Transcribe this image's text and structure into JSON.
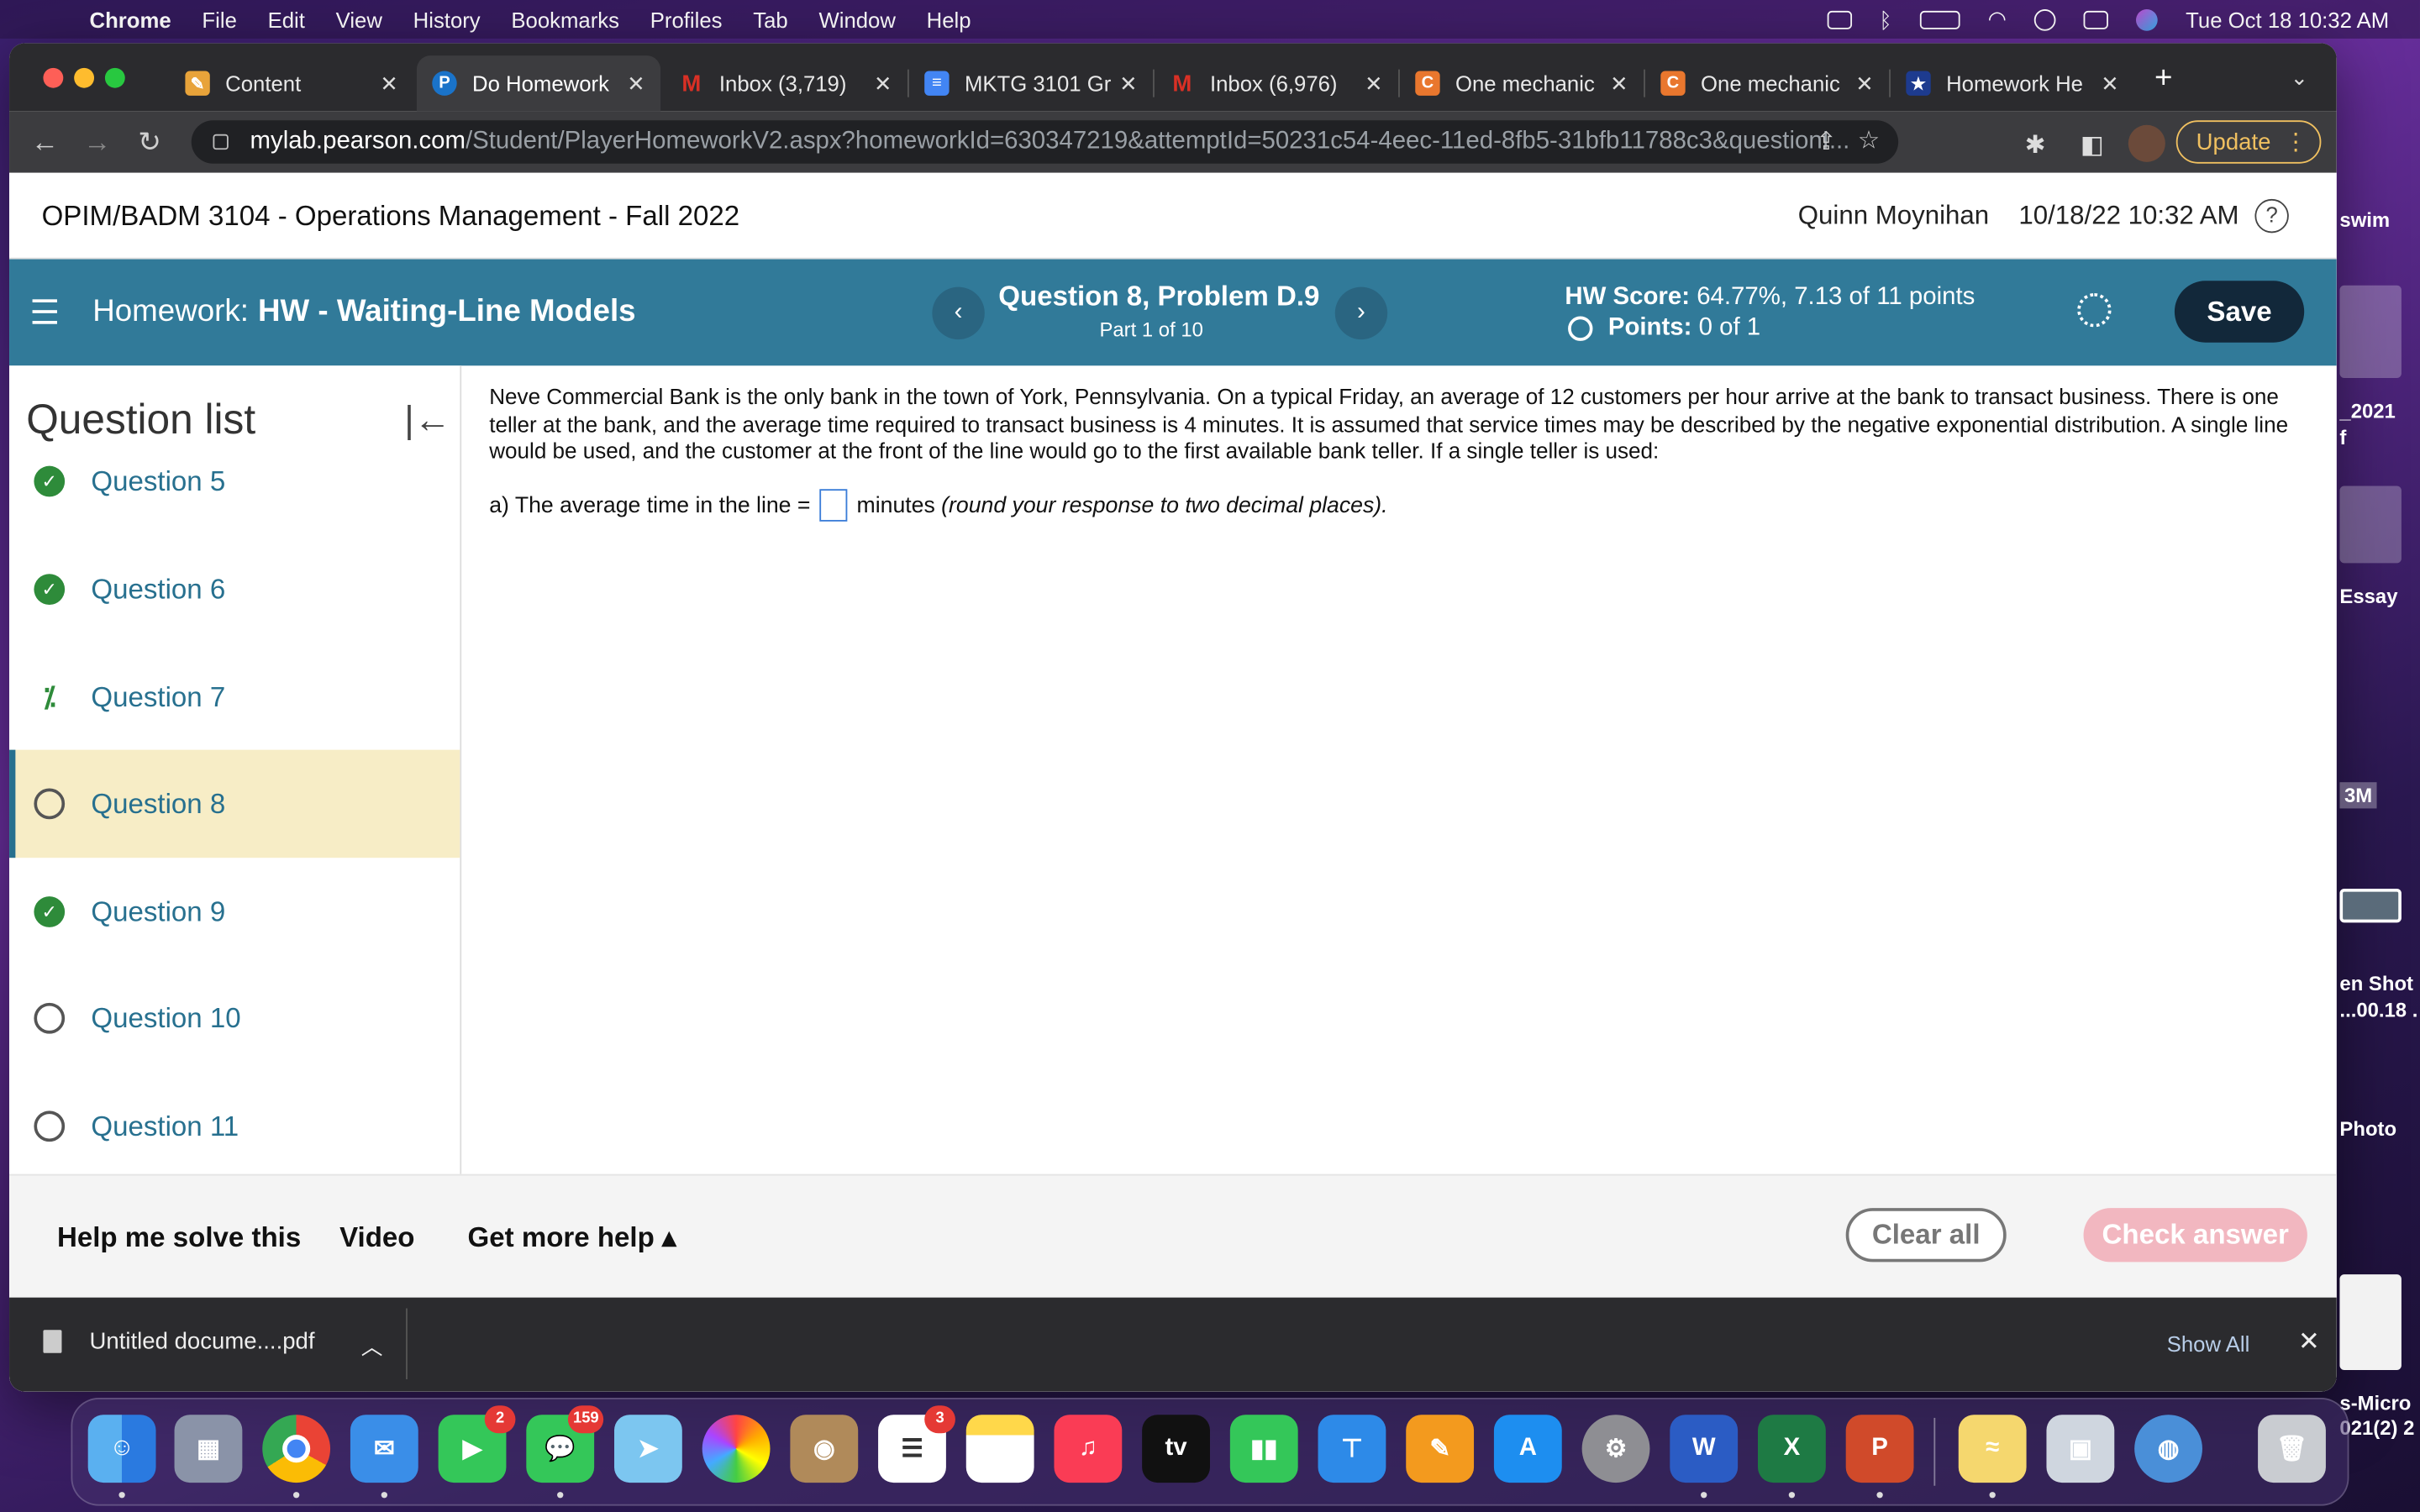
{
  "menubar": {
    "items": [
      "Chrome",
      "File",
      "Edit",
      "View",
      "History",
      "Bookmarks",
      "Profiles",
      "Tab",
      "Window",
      "Help"
    ],
    "clock": "Tue Oct 18  10:32 AM"
  },
  "browser": {
    "tabs": [
      {
        "label": "Content",
        "favicon_color": "#e8a33a",
        "favicon_glyph": "✎"
      },
      {
        "label": "Do Homework",
        "favicon_color": "#1a73c9",
        "favicon_glyph": "P"
      },
      {
        "label": "Inbox (3,719)",
        "favicon_color": "#d93025",
        "favicon_glyph": "M"
      },
      {
        "label": "MKTG 3101 Gr",
        "favicon_color": "#4285f4",
        "favicon_glyph": "≡"
      },
      {
        "label": "Inbox (6,976)",
        "favicon_color": "#d93025",
        "favicon_glyph": "M"
      },
      {
        "label": "One mechanic",
        "favicon_color": "#e9772e",
        "favicon_glyph": "C"
      },
      {
        "label": "One mechanic",
        "favicon_color": "#e9772e",
        "favicon_glyph": "C"
      },
      {
        "label": "Homework He",
        "favicon_color": "#1d3b8f",
        "favicon_glyph": "★"
      }
    ],
    "url_domain": "mylab.pearson.com",
    "url_path": "/Student/PlayerHomeworkV2.aspx?homeworkId=630347219&attemptId=50231c54-4eec-11ed-8fb5-31bfb11788c3&questionI...",
    "update_label": "Update"
  },
  "course": {
    "title": "OPIM/BADM 3104 - Operations Management - Fall 2022",
    "user": "Quinn Moynihan",
    "datetime": "10/18/22 10:32 AM"
  },
  "homework": {
    "prefix": "Homework:",
    "name": "HW - Waiting-Line Models",
    "question_title": "Question 8, Problem D.9",
    "part": "Part 1 of 10",
    "score_label": "HW Score:",
    "score_value": "64.77%, 7.13 of 11 points",
    "points_label": "Points:",
    "points_value": "0 of 1",
    "save_label": "Save"
  },
  "question_list": {
    "title": "Question list",
    "items": [
      {
        "label": "Question 5",
        "status": "done"
      },
      {
        "label": "Question 6",
        "status": "done"
      },
      {
        "label": "Question 7",
        "status": "partial"
      },
      {
        "label": "Question 8",
        "status": "open"
      },
      {
        "label": "Question 9",
        "status": "done"
      },
      {
        "label": "Question 10",
        "status": "open"
      },
      {
        "label": "Question 11",
        "status": "open"
      }
    ]
  },
  "problem": {
    "text": "Neve Commercial Bank is the only bank in the town of York, Pennsylvania. On a typical Friday, an average of 12 customers per hour arrive at the bank to transact business. There is one teller at the bank, and the average time required to transact business is 4 minutes.  It is assumed that service times may be described by the negative exponential distribution. A single line would be used, and the customer at the front of the line would go to the first available bank teller. If a single teller is used:",
    "part_a_prefix": "a) The average time in the line =",
    "part_a_unit": "minutes",
    "part_a_hint": "(round your response to two decimal places)."
  },
  "help": {
    "help_me": "Help me solve this",
    "video": "Video",
    "more_help": "Get more help ▴",
    "clear_all": "Clear all",
    "check_answer": "Check answer"
  },
  "downloads": {
    "file": "Untitled docume....pdf",
    "show_all": "Show All"
  },
  "desktop_labels": [
    "swim",
    "_2021",
    "f",
    "Essay",
    "3M",
    "en Shot",
    "...00.18 .",
    "Photo",
    "s-Micro",
    "021(2) 2"
  ],
  "dock": {
    "badges": {
      "facetime": "2",
      "messages": "159",
      "reminders": "3"
    },
    "apps": [
      "finder",
      "launchpad",
      "chrome",
      "mail",
      "facetime",
      "messages",
      "maps",
      "photos",
      "contacts",
      "reminders",
      "notes",
      "music",
      "tv",
      "numbers",
      "keynote",
      "pages",
      "appstore",
      "settings",
      "word",
      "excel",
      "powerpoint",
      "stickies",
      "preview",
      "network",
      "trash"
    ]
  }
}
